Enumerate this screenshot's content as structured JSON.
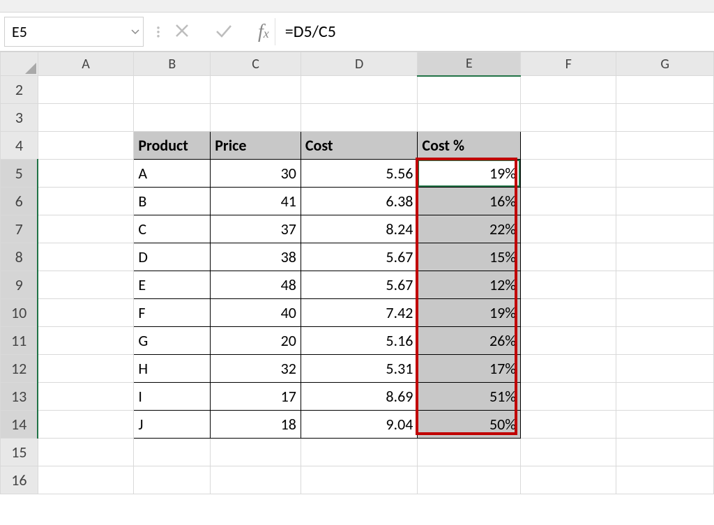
{
  "name_box": "E5",
  "formula": "=D5/C5",
  "columns": [
    "A",
    "B",
    "C",
    "D",
    "E",
    "F",
    "G"
  ],
  "row_start": 2,
  "row_end": 16,
  "active_cell": "E5",
  "headers": {
    "b": "Product",
    "c": "Price",
    "d": "Cost",
    "e": "Cost %"
  },
  "data": [
    {
      "product": "A",
      "price": "30",
      "cost": "5.56",
      "pct": "19%"
    },
    {
      "product": "B",
      "price": "41",
      "cost": "6.38",
      "pct": "16%"
    },
    {
      "product": "C",
      "price": "37",
      "cost": "8.24",
      "pct": "22%"
    },
    {
      "product": "D",
      "price": "38",
      "cost": "5.67",
      "pct": "15%"
    },
    {
      "product": "E",
      "price": "48",
      "cost": "5.67",
      "pct": "12%"
    },
    {
      "product": "F",
      "price": "40",
      "cost": "7.42",
      "pct": "19%"
    },
    {
      "product": "G",
      "price": "20",
      "cost": "5.16",
      "pct": "26%"
    },
    {
      "product": "H",
      "price": "32",
      "cost": "5.31",
      "pct": "17%"
    },
    {
      "product": "I",
      "price": "17",
      "cost": "8.69",
      "pct": "51%"
    },
    {
      "product": "J",
      "price": "18",
      "cost": "9.04",
      "pct": "50%"
    }
  ]
}
